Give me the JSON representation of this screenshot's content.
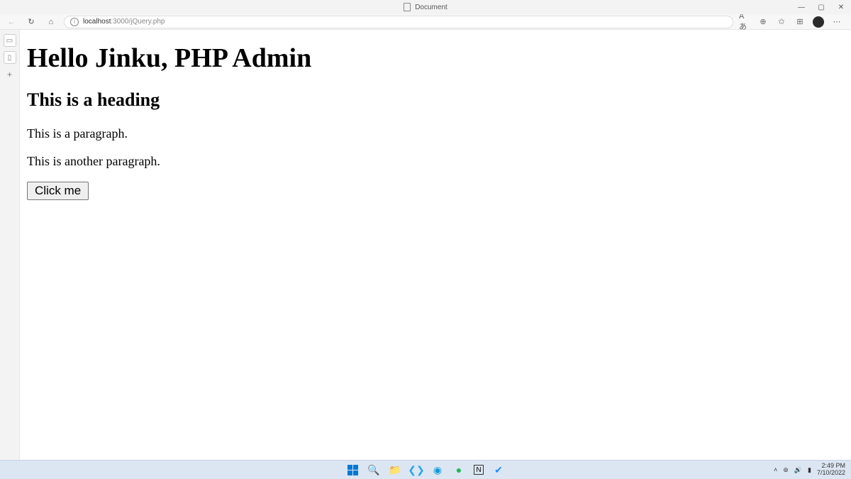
{
  "titlebar": {
    "title": "Document"
  },
  "addressbar": {
    "host": "localhost",
    "port_path": ":3000/jQuery.php"
  },
  "page": {
    "h1": "Hello Jinku, PHP Admin",
    "h2": "This is a heading",
    "p1": "This is a paragraph.",
    "p2": "This is another paragraph.",
    "button_label": "Click me"
  },
  "taskbar": {
    "time": "2:49 PM",
    "date": "7/10/2022"
  }
}
